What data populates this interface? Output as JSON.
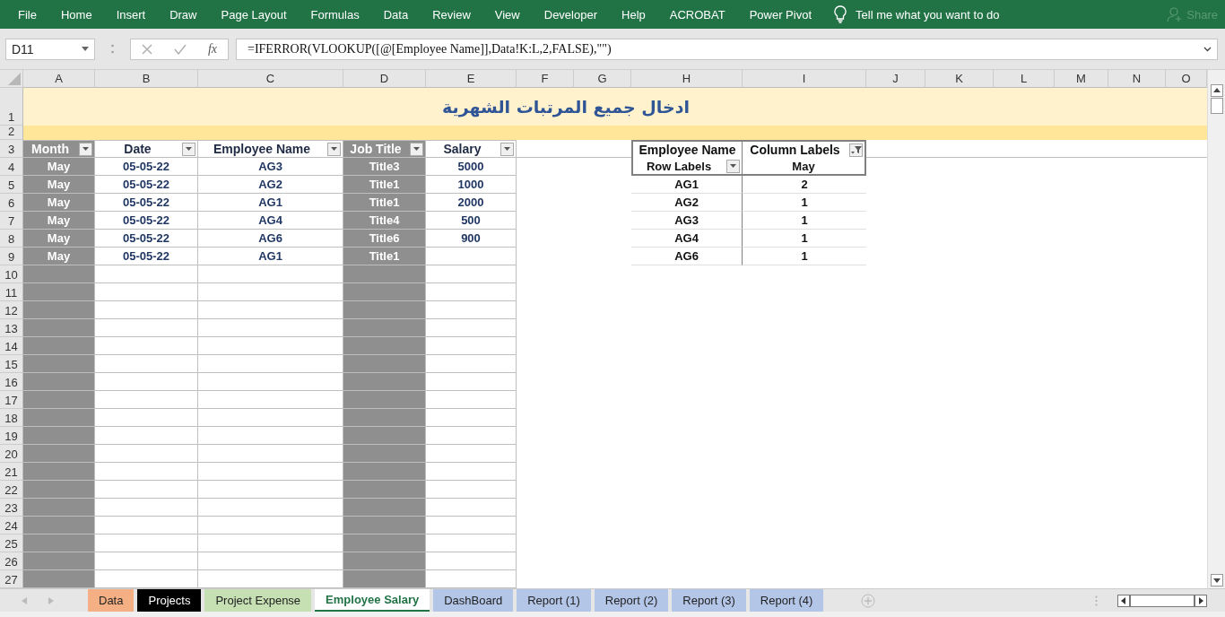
{
  "ribbon": {
    "tabs": [
      "File",
      "Home",
      "Insert",
      "Draw",
      "Page Layout",
      "Formulas",
      "Data",
      "Review",
      "View",
      "Developer",
      "Help",
      "ACROBAT",
      "Power Pivot"
    ],
    "tell_me": "Tell me what you want to do",
    "share": "Share"
  },
  "formula_bar": {
    "name_box": "D11",
    "function_button": "fx",
    "formula": "=IFERROR(VLOOKUP([@[Employee Name]],Data!K:L,2,FALSE),\"\")"
  },
  "columns": [
    "A",
    "B",
    "C",
    "D",
    "E",
    "F",
    "G",
    "H",
    "I",
    "J",
    "K",
    "L",
    "M",
    "N",
    "O"
  ],
  "row_numbers": [
    "1",
    "2",
    "3",
    "4",
    "5",
    "6",
    "7",
    "8",
    "9",
    "10",
    "11",
    "12",
    "13",
    "14",
    "15",
    "16",
    "17",
    "18",
    "19",
    "20",
    "21",
    "22",
    "23",
    "24",
    "25",
    "26",
    "27"
  ],
  "title": "ادخال جميع المرتبات الشهرية",
  "table": {
    "columns": [
      {
        "label": "Month",
        "kind": "shaded"
      },
      {
        "label": "Date",
        "kind": "plain"
      },
      {
        "label": "Employee Name",
        "kind": "plain"
      },
      {
        "label": "Job Title",
        "kind": "shaded"
      },
      {
        "label": "Salary",
        "kind": "plain"
      }
    ],
    "rows": [
      [
        "May",
        "05-05-22",
        "AG3",
        "Title3",
        "5000"
      ],
      [
        "May",
        "05-05-22",
        "AG2",
        "Title1",
        "1000"
      ],
      [
        "May",
        "05-05-22",
        "AG1",
        "Title1",
        "2000"
      ],
      [
        "May",
        "05-05-22",
        "AG4",
        "Title4",
        "500"
      ],
      [
        "May",
        "05-05-22",
        "AG6",
        "Title6",
        "900"
      ],
      [
        "May",
        "05-05-22",
        "AG1",
        "Title1"
      ]
    ]
  },
  "pivot": {
    "field": "Employee Name",
    "column_labels": "Column Labels",
    "column_filter_applied": true,
    "row_labels": "Row Labels",
    "column_item": "May",
    "rows": [
      {
        "label": "AG1",
        "value": "2"
      },
      {
        "label": "AG2",
        "value": "1"
      },
      {
        "label": "AG3",
        "value": "1"
      },
      {
        "label": "AG4",
        "value": "1"
      },
      {
        "label": "AG6",
        "value": "1"
      }
    ]
  },
  "sheet_tabs": [
    {
      "label": "Data",
      "color": "#f4b084",
      "selected": false
    },
    {
      "label": "Projects",
      "color": "#000000",
      "selected": false
    },
    {
      "label": "Project Expense",
      "color": "#c6e0b4",
      "selected": false
    },
    {
      "label": "Employee Salary",
      "selected": true
    },
    {
      "label": "DashBoard",
      "color": "#b4c6e7",
      "selected": false
    },
    {
      "label": "Report (1)",
      "color": "#b4c6e7",
      "selected": false
    },
    {
      "label": "Report (2)",
      "color": "#b4c6e7",
      "selected": false
    },
    {
      "label": "Report (3)",
      "color": "#b4c6e7",
      "selected": false
    },
    {
      "label": "Report (4)",
      "color": "#b4c6e7",
      "selected": false
    }
  ]
}
